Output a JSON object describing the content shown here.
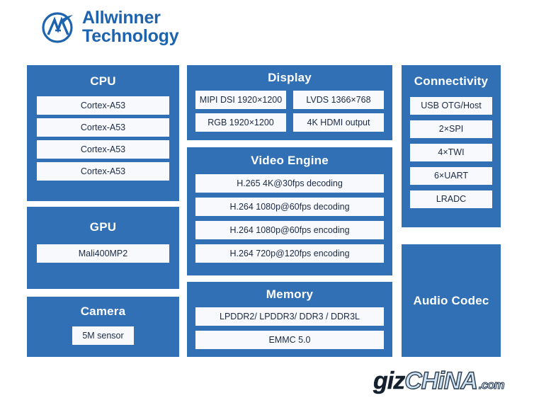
{
  "brand": {
    "logo_icon": "allwinner-aw-circle-logo",
    "line1": "Allwinner",
    "line2": "Technology",
    "color": "#1d63ad"
  },
  "theme": {
    "block_bg": "#3170b5",
    "cell_bg": "#f7f9fc",
    "cell_text": "#1b2a44",
    "title_text": "#ffffff",
    "page_bg": "#ffffff"
  },
  "blocks": {
    "cpu": {
      "title": "CPU",
      "items": [
        "Cortex-A53",
        "Cortex-A53",
        "Cortex-A53",
        "Cortex-A53"
      ]
    },
    "gpu": {
      "title": "GPU",
      "items": [
        "Mali400MP2"
      ]
    },
    "camera": {
      "title": "Camera",
      "items": [
        "5M sensor"
      ]
    },
    "display": {
      "title": "Display",
      "items": [
        "MIPI DSI 1920×1200",
        "LVDS 1366×768",
        "RGB 1920×1200",
        "4K HDMI output"
      ]
    },
    "video_engine": {
      "title": "Video Engine",
      "items": [
        "H.265 4K@30fps decoding",
        "H.264 1080p@60fps decoding",
        "H.264 1080p@60fps encoding",
        "H.264 720p@120fps encoding"
      ]
    },
    "memory": {
      "title": "Memory",
      "items": [
        "LPDDR2/ LPDDR3/ DDR3 / DDR3L",
        "EMMC 5.0"
      ]
    },
    "connectivity": {
      "title": "Connectivity",
      "items": [
        "USB OTG/Host",
        "2×SPI",
        "4×TWI",
        "6×UART",
        "LRADC"
      ]
    },
    "audio_codec": {
      "title": "Audio Codec",
      "items": []
    }
  },
  "watermark": {
    "part1": "giz",
    "part2": "CHiNA",
    "part3": ".com",
    "color_dark": "#15202e",
    "color_light": "#cfe4f5"
  }
}
